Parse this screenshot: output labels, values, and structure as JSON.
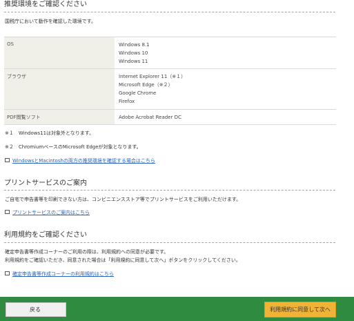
{
  "env_section": {
    "title": "推奨環境をご確認ください",
    "intro": "国税庁において動作を確認した環境です。",
    "rows": [
      {
        "label": "OS",
        "values": [
          "Windows 8.1",
          "Windows 10",
          "Windows 11"
        ]
      },
      {
        "label": "ブラウザ",
        "values": [
          "Internet Explorer 11（※１）",
          "Microsoft Edge（※２）",
          "Google Chrome",
          "Firefox"
        ]
      },
      {
        "label": "PDF閲覧ソフト",
        "values": [
          "Adobe Acrobat Reader DC"
        ]
      }
    ],
    "note1": "※１　Windows11は対象外となります。",
    "note2": "※２　ChromiumベースのMicrosoft Edgeが対象となります。",
    "link": "WindowsとMacintoshの両方の推奨環境を確認する場合はこちら"
  },
  "print_section": {
    "title": "プリントサービスのご案内",
    "text": "ご自宅で申告書等を印刷できない方は、コンビニエンスストア等でプリントサービスをご利用いただけます。",
    "link": "プリントサービスのご案内はこちら"
  },
  "terms_section": {
    "title": "利用規約をご確認ください",
    "text1": "確定申告書等作成コーナーのご利用の際は、利用規約への同意が必要です。",
    "text2": "利用規約をご確認いただき、同意された場合は「利用規約に同意して次へ」ボタンをクリックしてください。",
    "link": "確定申告書等作成コーナーの利用規約はこちら"
  },
  "footer": {
    "back_label": "戻る",
    "next_label": "利用規約に同意して次へ"
  },
  "colors": {
    "footer_bg": "#2e8b3f",
    "accent_dash": "#e39a2a",
    "next_button": "#f1b335",
    "link": "#2a63b8"
  }
}
